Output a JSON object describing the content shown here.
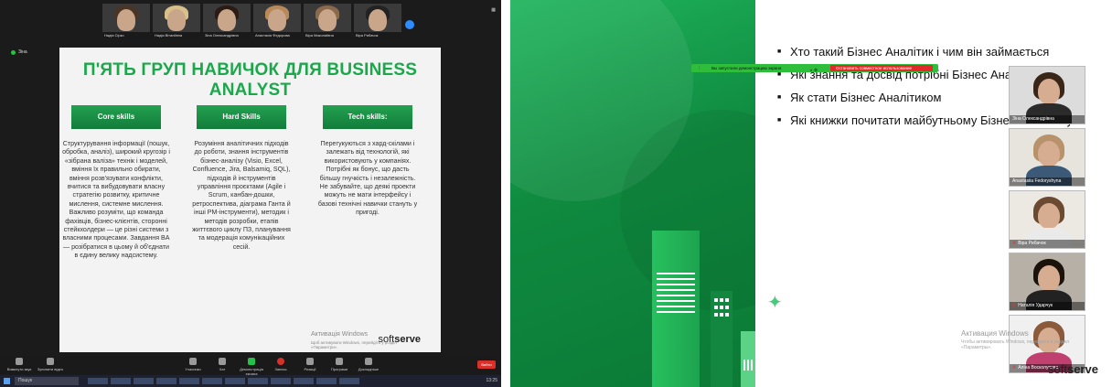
{
  "left": {
    "participants": [
      "Надія Сірко",
      "Надія Віталіївна",
      "Зіна Олександрівна",
      "Анастасія Федорова",
      "Віра Миколаївна",
      "Віра Рибачок"
    ],
    "talking_label": "Зіна",
    "slide": {
      "title": "П'ЯТЬ ГРУП НАВИЧОК ДЛЯ BUSINESS ANALYST",
      "columns": [
        {
          "header": "Core skills",
          "body": "Структурування інформації (пошук, обробка, аналіз), широкий кругозір і «зібрана валіза» технік і моделей, вміння їх правильно обирати, вміння розв'язувати конфлікти, вчитися та вибудовувати власну стратегію розвитку, критичне мислення, системне мислення. Важливо розуміти, що команда фахівців, бізнес-клієнтів, сторонні стейкхолдери — це різні системи з власними процесами. Завдання BA — розібратися в цьому й об'єднати в єдину велику надсистему."
        },
        {
          "header": "Hard Skills",
          "body": "Розуміння аналітичних підходів до роботи, знання інструментів бізнес-аналізу (Visio, Excel, Confluence, Jira, Balsamiq, SQL), підходів й інструментів управління проєктами (Agile і Scrum, канбан-дошки, ретроспектива, діаграма Ганта й інші PM-інструменти), методик і методів розробки, етапів життєвого циклу ПЗ, планування та модерація комунікаційних сесій."
        },
        {
          "header": "Tech skills:",
          "body": "Перегукуються з хард-скілами і залежать від технологій, які використовують у компаніях. Потрібні як бонус, що дасть більшу гнучкість і незалежність. Не забувайте, що деякі проекти можуть не мати інтерфейсу і базові технічні навички стануть у пригоді."
        }
      ],
      "brand_soft": "soft",
      "brand_serve": "serve"
    },
    "watermark": "Активація Windows",
    "watermark_sub": "Щоб активувати Windows, перейдіть у розділ «Параметри».",
    "toolbar": {
      "mute": "Вимкнути звук",
      "video": "Зупинити відео",
      "participants": "Учасники",
      "chat": "Чат",
      "share": "Демонстрація екрана",
      "record": "Запись",
      "reactions": "Реакції",
      "apps": "Програми",
      "more": "Докладніше",
      "leave": "Вийти"
    },
    "taskbar": {
      "search": "Пошук",
      "clock": "13:25"
    }
  },
  "right": {
    "bullets": [
      "Хто такий Бізнес Аналітик і чим він займається",
      "Які знання та досвід потрібні Бізнес Аналітику",
      "Як стати Бізнес Аналітиком",
      "Які книжки почитати майбутньому Бізнес Аналітику"
    ],
    "share_bar": {
      "notice": "Вы запустили демонстрацию экрана",
      "stop": "Остановить совместное использование"
    },
    "gallery": [
      "Зіна Олександрівна",
      "Anastasiia Fedoryshyna",
      "Віра Рибачок",
      "Наталія Ударчук",
      "Аліна Восколупова"
    ],
    "watermark": "Активация Windows",
    "watermark_sub": "Чтобы активировать Windows, перейдите в раздел «Параметры».",
    "brand_soft": "soft",
    "brand_serve": "serve"
  }
}
